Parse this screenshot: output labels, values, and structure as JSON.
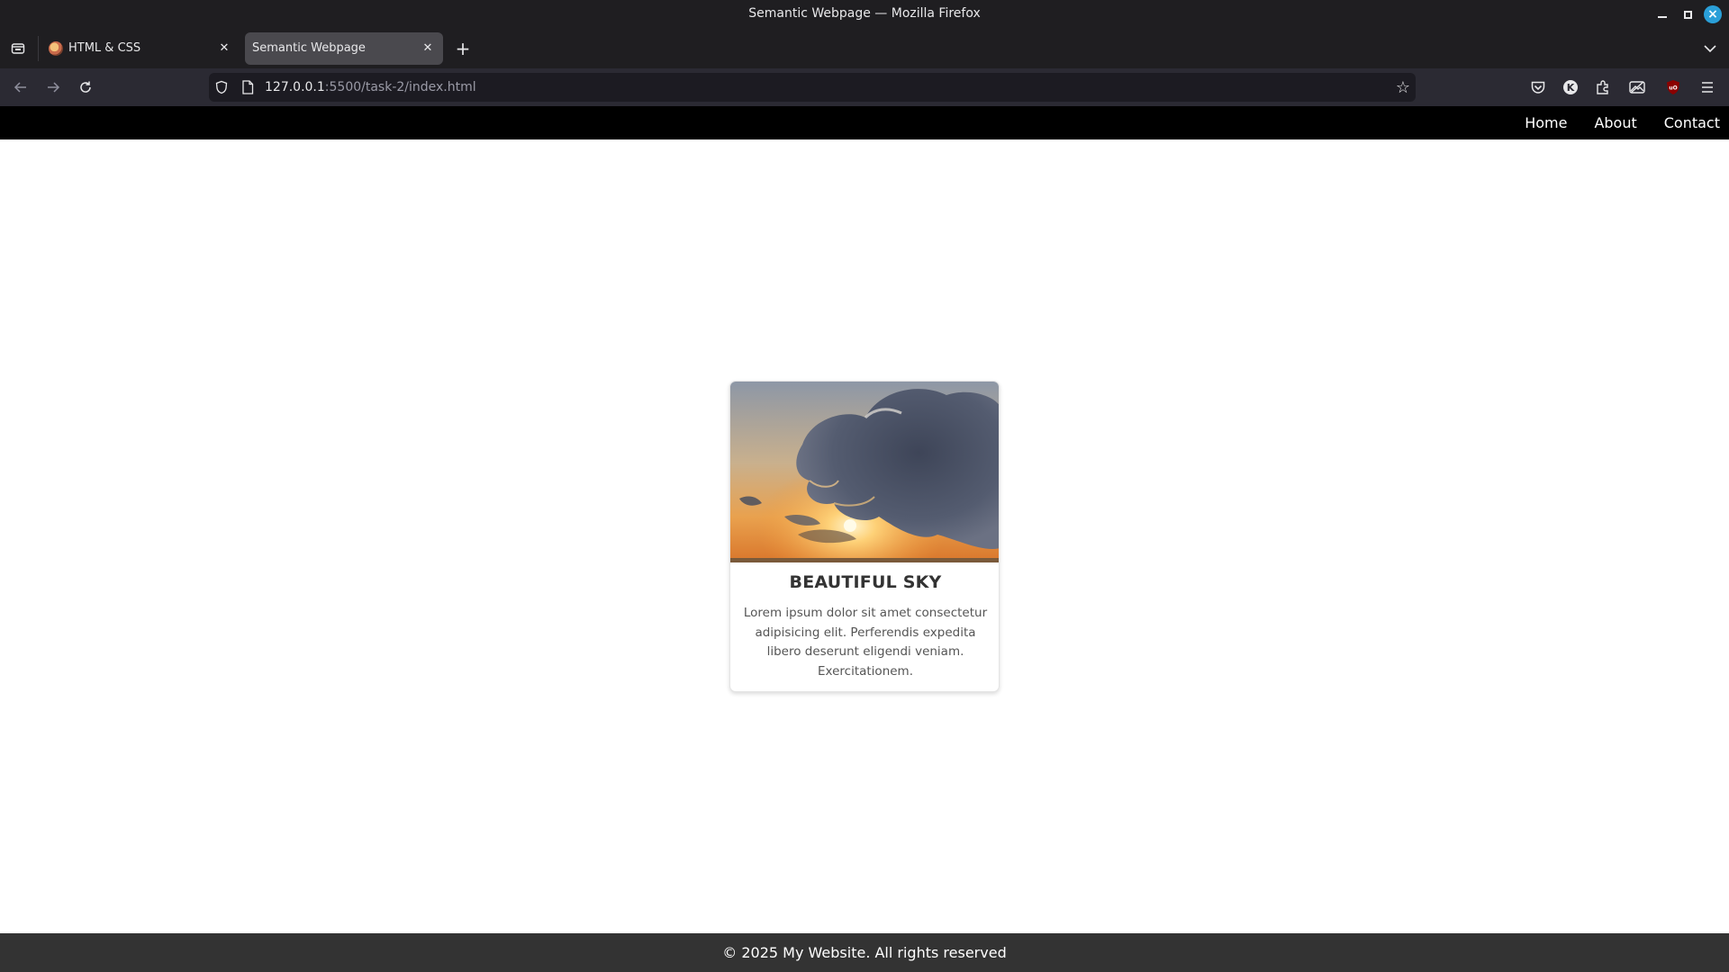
{
  "window": {
    "title": "Semantic Webpage — Mozilla Firefox"
  },
  "tabs": [
    {
      "label": "HTML & CSS",
      "favicon": "palette-icon",
      "active": false
    },
    {
      "label": "Semantic Webpage",
      "active": true
    }
  ],
  "address_bar": {
    "url_host": "127.0.0.1",
    "url_rest": ":5500/task-2/index.html"
  },
  "toolbar_icons": [
    "pocket-icon",
    "k-extension-icon",
    "extensions-icon",
    "image-extension-icon",
    "ublock-origin-icon",
    "menu-icon"
  ],
  "page": {
    "nav": [
      "Home",
      "About",
      "Contact"
    ],
    "card": {
      "title": "BEAUTIFUL SKY",
      "text": "Lorem ipsum dolor sit amet consectetur adipisicing elit. Perferendis expedita libero deserunt eligendi veniam. Exercitationem.",
      "image": "sunset-sky-with-clouds"
    },
    "footer": "© 2025 My Website. All rights reserved"
  },
  "colors": {
    "header_bg": "#000000",
    "footer_bg": "#333333",
    "chrome_bg": "#1f1e21",
    "navbar_bg": "#2b2a33"
  }
}
